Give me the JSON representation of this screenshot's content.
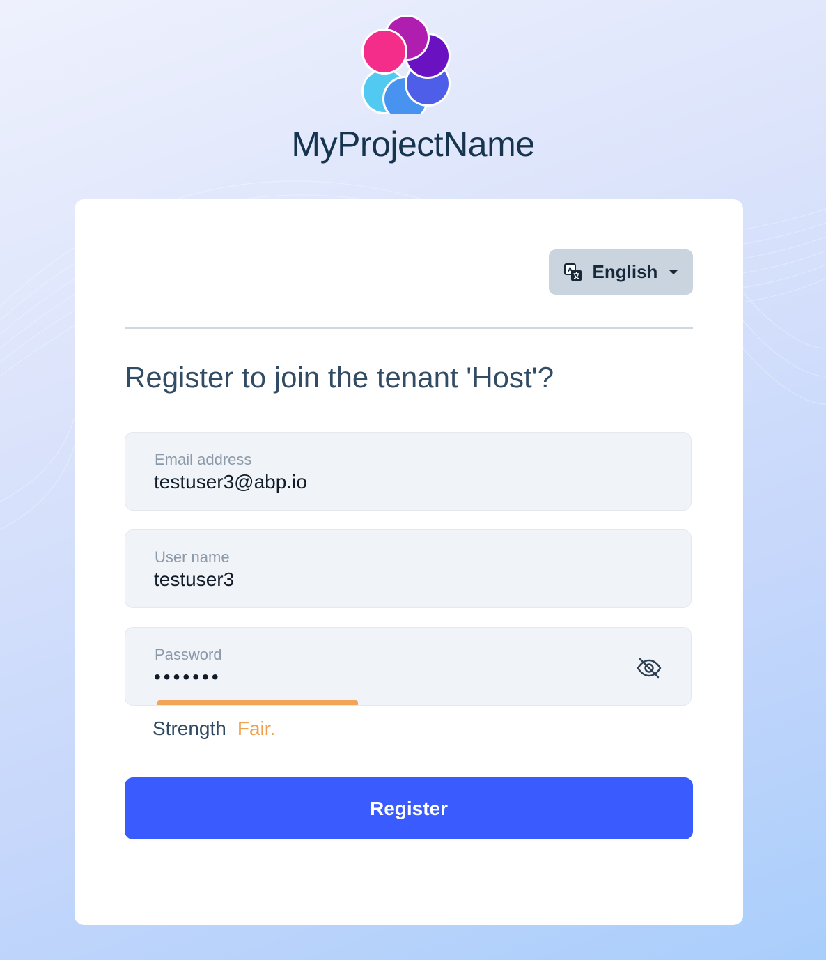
{
  "brand": {
    "name": "MyProjectName",
    "logo_icon": "abp-flower-logo-icon",
    "logo_colors": [
      "#f52d8a",
      "#b01eaf",
      "#6a12c2",
      "#4e5ee8",
      "#4893ef",
      "#52c9f1"
    ]
  },
  "language": {
    "icon": "translate-icon",
    "selected": "English"
  },
  "form": {
    "title": "Register to join the tenant 'Host'?",
    "email": {
      "label": "Email address",
      "value": "testuser3@abp.io"
    },
    "username": {
      "label": "User name",
      "value": "testuser3"
    },
    "password": {
      "label": "Password",
      "value": "1q2w3E*",
      "toggle_icon": "eye-slash-icon",
      "strength_label": "Strength",
      "strength_value": "Fair.",
      "strength_fraction": 0.4
    },
    "submit_label": "Register"
  },
  "colors": {
    "primary": "#3a5bfe",
    "strength": "#f3a557",
    "heading": "#314c64"
  }
}
